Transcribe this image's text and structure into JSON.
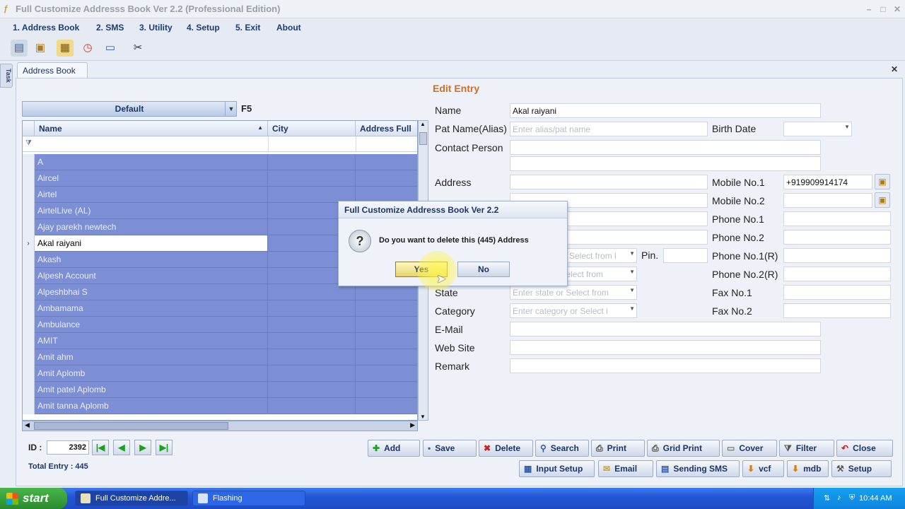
{
  "window": {
    "title": "Full Customize Addresss Book Ver 2.2 (Professional Edition)"
  },
  "menu": [
    "1. Address Book",
    "2. SMS",
    "3. Utility",
    "4. Setup",
    "5. Exit",
    "About"
  ],
  "side_tab": "Task",
  "doc_tab": "Address Book",
  "edit_title": "Edit Entry",
  "grid": {
    "group_label": "Default",
    "shortcut": "F5",
    "columns": [
      "Name",
      "City",
      "Address Full"
    ],
    "rows": [
      "A",
      "Aircel",
      "Airtel",
      "AirtelLive (AL)",
      "Ajay parekh newtech",
      "Akal raiyani",
      "Akash",
      "Alpesh Account",
      "Alpeshbhai S",
      "Ambamama",
      "Ambulance",
      "AMIT",
      "Amit ahm",
      "Amit Aplomb",
      "Amit patel Aplomb",
      "Amit tanna Aplomb"
    ],
    "current_row": "Akal raiyani"
  },
  "form": {
    "name_label": "Name",
    "name_value": "Akal raiyani",
    "pat_label": "Pat Name(Alias)",
    "pat_placeholder": "Enter alias/pat name",
    "birth_label": "Birth Date",
    "contact_label": "Contact Person",
    "address_label": "Address",
    "pin_label": "Pin.",
    "state_label": "State",
    "state_placeholder": "Enter state or Select from",
    "category_label": "Category",
    "category_placeholder": "Enter category or Select i",
    "city_placeholder": "Select from l",
    "country_placeholder": "r Select from",
    "email_label": "E-Mail",
    "website_label": "Web Site",
    "remark_label": "Remark",
    "mobile1_label": "Mobile No.1",
    "mobile1_value": "+919909914174",
    "mobile2_label": "Mobile No.2",
    "phone1_label": "Phone No.1",
    "phone2_label": "Phone No.2",
    "phone1r_label": "Phone No.1(R)",
    "phone2r_label": "Phone No.2(R)",
    "fax1_label": "Fax No.1",
    "fax2_label": "Fax No.2"
  },
  "footer": {
    "id_label": "ID :",
    "id_value": "2392",
    "total": "Total Entry : 445",
    "buttons_row1": [
      "Add",
      "Save",
      "Delete",
      "Search",
      "Print",
      "Grid Print",
      "Cover",
      "Filter",
      "Close"
    ],
    "buttons_row2": [
      "Input Setup",
      "Email",
      "Sending SMS",
      "vcf",
      "mdb",
      "Setup"
    ]
  },
  "dialog": {
    "title": "Full Customize Addresss Book Ver 2.2",
    "message": "Do you want to delete this (445) Address",
    "yes": "Yes",
    "no": "No"
  },
  "taskbar": {
    "start": "start",
    "tasks": [
      "Full Customize Addre...",
      "Flashing"
    ],
    "clock": "10:44 AM"
  }
}
